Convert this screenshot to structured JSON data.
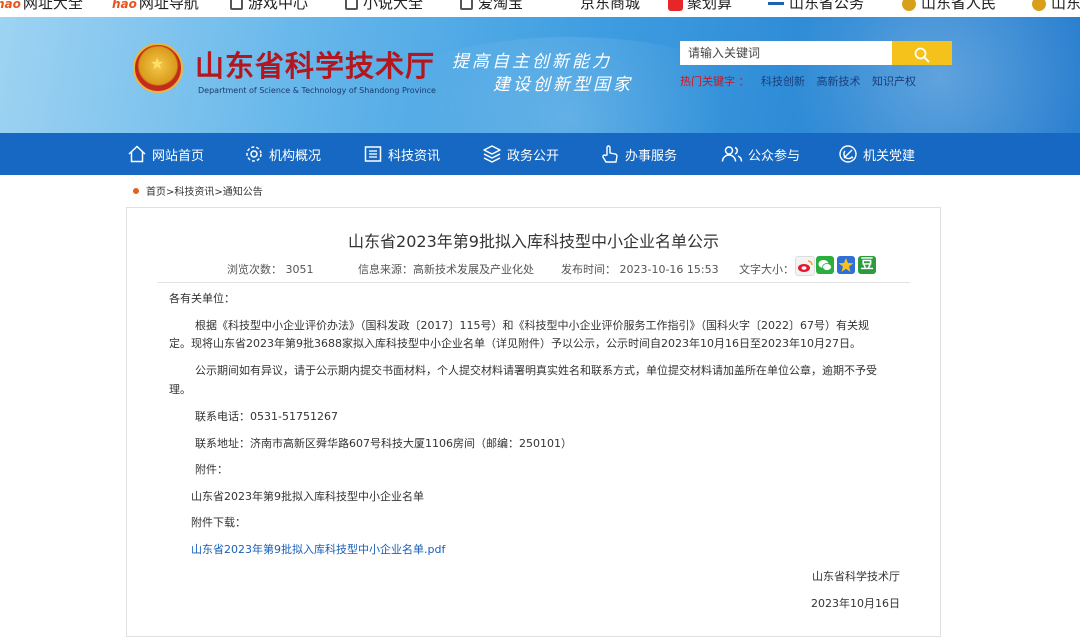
{
  "bookmarks": [
    "网址大全",
    "网址导航",
    "游戏中心",
    "小说大全",
    "爱淘宝",
    "京东商城",
    "聚划算",
    "山东省公务",
    "山东省人民",
    "山东"
  ],
  "header": {
    "site_title": "山东省科学技术厅",
    "site_subtitle": "Department of Science & Technology of Shandong Province",
    "slogan_line1": "提高自主创新能力",
    "slogan_line2": "建设创新型国家",
    "search_placeholder": "请输入关键词",
    "hot_label": "热门关键字 ：",
    "hot_keywords": [
      "科技创新",
      "高新技术",
      "知识产权"
    ]
  },
  "nav": [
    {
      "label": "网站首页",
      "icon": "home-icon"
    },
    {
      "label": "机构概况",
      "icon": "gear-icon"
    },
    {
      "label": "科技资讯",
      "icon": "news-icon"
    },
    {
      "label": "政务公开",
      "icon": "layers-icon"
    },
    {
      "label": "办事服务",
      "icon": "hand-icon"
    },
    {
      "label": "公众参与",
      "icon": "people-icon"
    },
    {
      "label": "机关党建",
      "icon": "party-icon"
    }
  ],
  "breadcrumb": {
    "items": [
      "首页",
      "科技资讯",
      "通知公告"
    ],
    "separator": ">"
  },
  "article": {
    "title": "山东省2023年第9批拟入库科技型中小企业名单公示",
    "meta": {
      "views_label": "浏览次数：",
      "views": "3051",
      "source_label": "信息来源：",
      "source": "高新技术发展及产业化处",
      "time_label": "发布时间：",
      "time": "2023-10-16 15:53",
      "font_label": "文字大小："
    },
    "share_icons": [
      "weibo-icon",
      "wechat-icon",
      "qzone-icon",
      "douban-icon"
    ],
    "douban_glyph": "豆",
    "body": {
      "greeting": "各有关单位：",
      "p1_line1": "根据《科技型中小企业评价办法》（国科发政〔2017〕115号）和《科技型中小企业评价服务工作指引》（国科火字〔2022〕67号）有关规",
      "p1_line2": "定。现将山东省2023年第9批3688家拟入库科技型中小企业名单（详见附件）予以公示，公示时间自2023年10月16日至2023年10月27日。",
      "p2_line1": "公示期间如有异议，请于公示期内提交书面材料，个人提交材料请署明真实姓名和联系方式，单位提交材料请加盖所在单位公章，逾期不予受",
      "p2_line2": "理。",
      "phone": "联系电话：0531-51751267",
      "address": "联系地址：济南市高新区舜华路607号科技大厦1106房间（邮编：250101）",
      "attachment_label": "附件：",
      "attachment_name": "山东省2023年第9批拟入库科技型中小企业名单",
      "download_label": "附件下载：",
      "download_link": "山东省2023年第9批拟入库科技型中小企业名单.pdf",
      "signature": "山东省科学技术厅",
      "date": "2023年10月16日"
    }
  },
  "colors": {
    "nav_blue": "#1668c2",
    "title_red": "#b3161c",
    "search_yellow": "#f4c21b",
    "link_blue": "#1a5fb4",
    "breadcrumb_dot": "#e0631b"
  }
}
